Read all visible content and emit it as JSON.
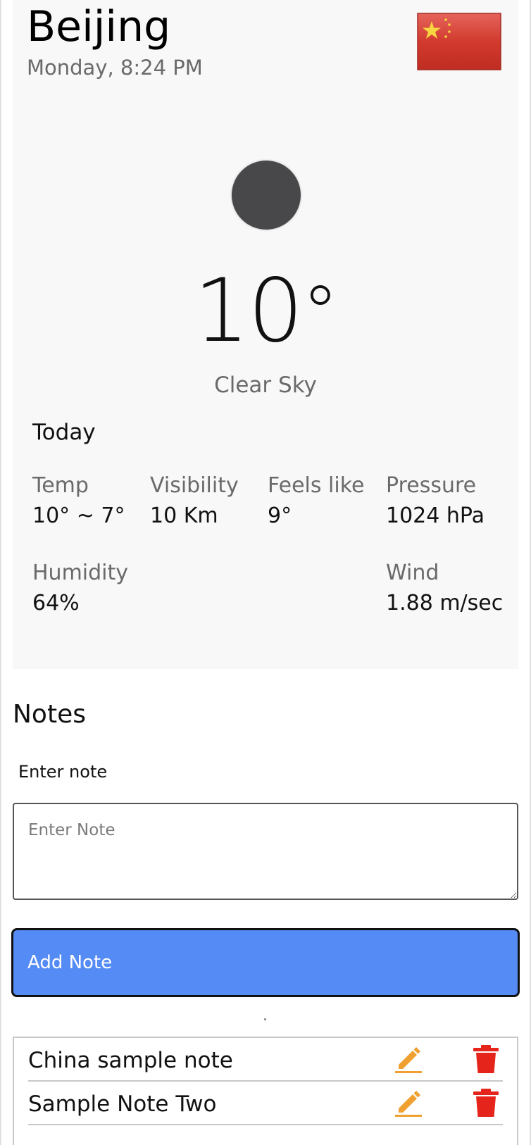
{
  "weather": {
    "city": "Beijing",
    "datetime": "Monday, 8:24 PM",
    "flag_icon": "china-flag-icon",
    "condition_icon": "moon-icon",
    "temperature": "10",
    "degree_symbol": "°",
    "condition": "Clear Sky",
    "today_label": "Today",
    "stats": {
      "temp": {
        "label": "Temp",
        "value": "10° ~ 7°"
      },
      "visibility": {
        "label": "Visibility",
        "value": "10 Km"
      },
      "feels_like": {
        "label": "Feels like",
        "value": "9°"
      },
      "pressure": {
        "label": "Pressure",
        "value": "1024 hPa"
      },
      "humidity": {
        "label": "Humidity",
        "value": "64%"
      },
      "wind": {
        "label": "Wind",
        "value": "1.88 m/sec"
      }
    }
  },
  "notes": {
    "heading": "Notes",
    "input_label": "Enter note",
    "input_placeholder": "Enter Note",
    "input_value": "",
    "add_button_label": "Add Note",
    "items": [
      {
        "text": "China sample note",
        "edit_icon": "pencil-icon",
        "delete_icon": "trash-icon"
      },
      {
        "text": "Sample Note Two",
        "edit_icon": "pencil-icon",
        "delete_icon": "trash-icon"
      }
    ]
  },
  "colors": {
    "card_background": "#f8f8f8",
    "button_blue": "#558bf4",
    "edit_orange": "#f0a030",
    "delete_red": "#e5251b",
    "muted_text": "#6a6a6a"
  }
}
